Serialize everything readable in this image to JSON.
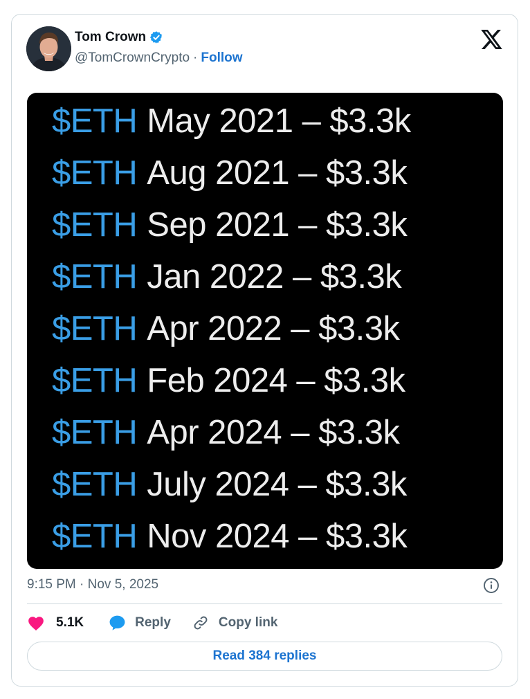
{
  "author": {
    "name": "Tom Crown",
    "handle": "@TomCrownCrypto",
    "separator": "·",
    "follow_label": "Follow"
  },
  "media": {
    "rows": [
      {
        "ticker": "$ETH",
        "text": "May 2021 – $3.3k"
      },
      {
        "ticker": "$ETH",
        "text": "Aug 2021 – $3.3k"
      },
      {
        "ticker": "$ETH",
        "text": "Sep 2021 – $3.3k"
      },
      {
        "ticker": "$ETH",
        "text": "Jan 2022 – $3.3k"
      },
      {
        "ticker": "$ETH",
        "text": "Apr 2022 – $3.3k"
      },
      {
        "ticker": "$ETH",
        "text": "Feb 2024 – $3.3k"
      },
      {
        "ticker": "$ETH",
        "text": "Apr 2024 – $3.3k"
      },
      {
        "ticker": "$ETH",
        "text": "July 2024 – $3.3k"
      },
      {
        "ticker": "$ETH",
        "text": "Nov 2024 – $3.3k"
      }
    ]
  },
  "timestamp": "9:15 PM · Nov 5, 2025",
  "actions": {
    "like_count": "5.1K",
    "reply_label": "Reply",
    "copy_link_label": "Copy link"
  },
  "read_replies_label": "Read 384 replies",
  "icons": {
    "verified": "verified-badge-icon",
    "platform": "x-logo-icon",
    "info": "info-icon",
    "like": "heart-icon",
    "reply": "speech-bubble-icon",
    "copy": "link-icon"
  },
  "colors": {
    "accent": "#1d74d0",
    "verified": "#1d9bf0",
    "like": "#f91880",
    "ticker": "#3a9ee6",
    "media_bg": "#000000",
    "muted": "#536471"
  }
}
